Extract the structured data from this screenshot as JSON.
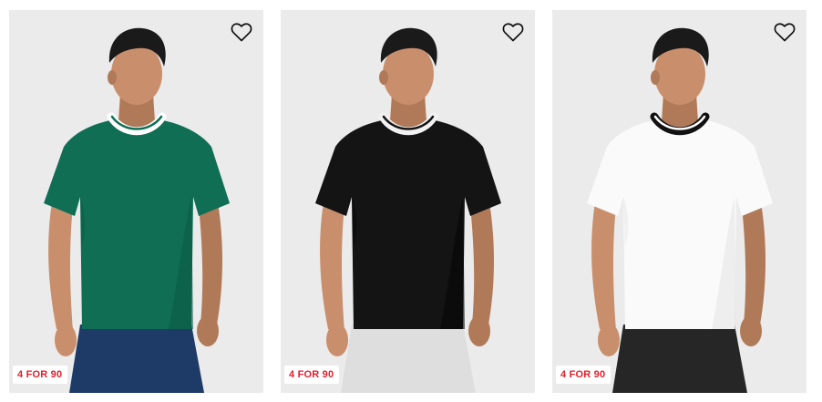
{
  "products": [
    {
      "badge": "4 FOR 90",
      "wishlist_icon": "heart-outline-icon",
      "colors": {
        "shirt": "#0f6e54",
        "shirt_shade": "#0a5a44",
        "collar_band": "#ffffff",
        "collar_stripe": "#0f6e54",
        "pants": "#1e3a66"
      }
    },
    {
      "badge": "4 FOR 90",
      "wishlist_icon": "heart-outline-icon",
      "colors": {
        "shirt": "#141414",
        "shirt_shade": "#050505",
        "collar_band": "#f2f2f2",
        "collar_stripe": "#141414",
        "pants": "#dedede"
      }
    },
    {
      "badge": "4 FOR 90",
      "wishlist_icon": "heart-outline-icon",
      "colors": {
        "shirt": "#fafafa",
        "shirt_shade": "#e6e6e6",
        "collar_band": "#111111",
        "collar_stripe": "#ffffff",
        "pants": "#262626"
      }
    }
  ],
  "theme": {
    "badge_text_color": "#e0202c",
    "card_background": "#ebebeb"
  }
}
